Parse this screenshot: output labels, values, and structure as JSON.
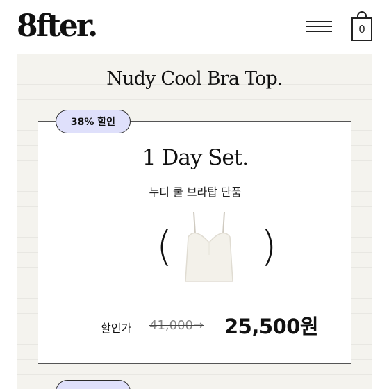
{
  "header": {
    "logo": "8fter.",
    "cart_count": "0"
  },
  "product": {
    "title": "Nudy Cool Bra Top.",
    "offer": {
      "badge": "38% 할인",
      "set_title": "1 Day Set.",
      "subtitle": "누디 쿨 브라탑 단품",
      "price_label": "할인가",
      "original_price": "41,000→",
      "final_price": "25,500원"
    }
  },
  "colors": {
    "badge_bg": "#dfe0fb",
    "paper_bg": "#f4f3ee"
  }
}
